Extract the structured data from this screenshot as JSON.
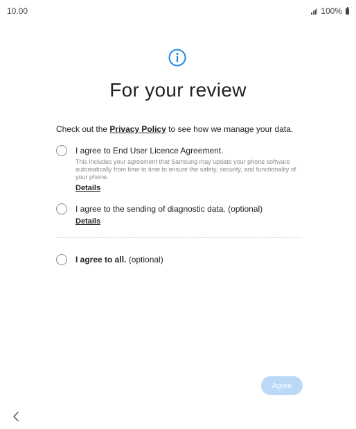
{
  "status_bar": {
    "time": "10.00",
    "battery": "100%",
    "icons": [
      "signal-icon",
      "battery-icon"
    ]
  },
  "header": {
    "icon": "info-icon",
    "title": "For your review"
  },
  "intro": {
    "prefix": "Check out the ",
    "link": "Privacy Policy",
    "suffix": " to see how we manage your data."
  },
  "options": [
    {
      "label": "I agree to End User Licence Agreement.",
      "description": "This includes your agreement that Samsung may update your phone software automatically from time to time to ensure the safety, security, and functionality of your phone.",
      "details": "Details",
      "checked": false
    },
    {
      "label": "I agree to the sending of diagnostic data. (optional)",
      "details": "Details",
      "checked": false
    }
  ],
  "agree_all": {
    "label_bold": "I agree to all.",
    "label_rest": " (optional)",
    "checked": false
  },
  "actions": {
    "agree_label": "Agree"
  },
  "colors": {
    "accent": "#1e88e5",
    "agree_disabled": "#b9d9f7"
  },
  "nav": {
    "back_icon": "chevron-left-icon"
  }
}
